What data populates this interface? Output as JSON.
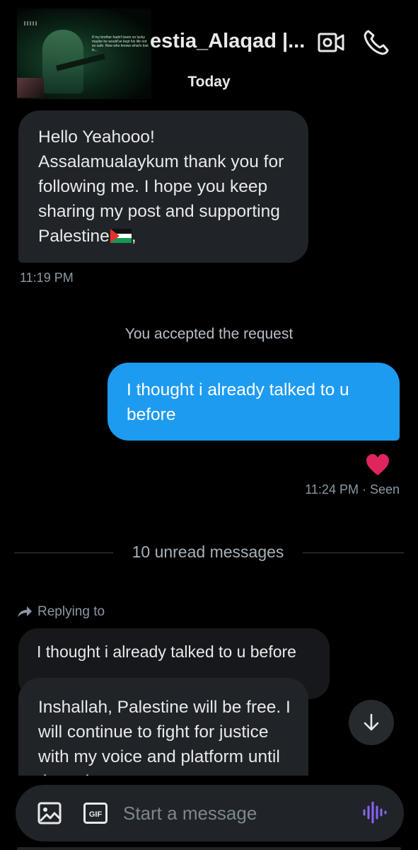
{
  "header": {
    "contact_name": "estia_Alaqad |...",
    "thumbnail_caption": "If my brother hadn't been so lucky maybe he would've kept his life not so safe. Now who knows what's lost is...",
    "date_label": "Today"
  },
  "messages": {
    "first_incoming": {
      "text": "Hello Yeahooo! Assalamualaykum thank you for following me. I hope you keep sharing my post and supporting Palestine",
      "trailing": ",",
      "time": "11:19 PM"
    },
    "system_note": "You accepted the request",
    "outgoing": {
      "text": "I thought i already talked to u before",
      "time_status": "11:24 PM · Seen",
      "reaction": "heart-emoji"
    },
    "unread_divider": "10 unread messages",
    "reply": {
      "label": "Replying to",
      "quoted_text": "I thought i already talked to u before",
      "text": "Inshallah, Palestine will be free. I will continue to fight for justice with my voice and platform until the voice"
    }
  },
  "composer": {
    "placeholder": "Start a message",
    "gif_label": "GIF"
  },
  "colors": {
    "background": "#000000",
    "incoming_bubble": "#202327",
    "outgoing_bubble": "#1d9bf0",
    "muted_text": "#8b98a5",
    "voice_accent": "#8a63f5",
    "heart": "#e0245e"
  }
}
